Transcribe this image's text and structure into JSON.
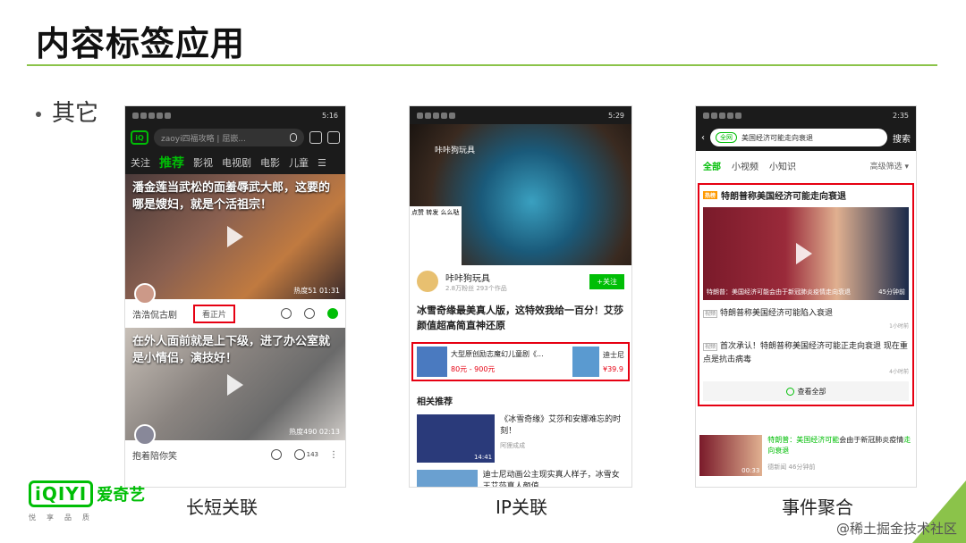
{
  "slide": {
    "title": "内容标签应用",
    "bullet": "其它",
    "captions": [
      "长短关联",
      "IP关联",
      "事件聚合"
    ],
    "watermark": "@稀土掘金技术社区",
    "logo": {
      "mark": "iQIYI",
      "name": "爱奇艺",
      "tagline": "悦享品质"
    },
    "accent": "#8bc34a",
    "highlight": "#e60012"
  },
  "phone1": {
    "time": "5:16",
    "search_placeholder": "zaoyi四福攻略 | 屈嵌...",
    "tabs": [
      "关注",
      "推荐",
      "影视",
      "电视剧",
      "电影",
      "儿童"
    ],
    "active_tab": "推荐",
    "card1": {
      "caption": "潘金莲当武松的面羞辱武大郎，这要的哪是嫂妇，就是个活祖宗！",
      "stats": "热度51  01:31",
      "author": "浩浩侃古剧",
      "watch_label": "看正片"
    },
    "card2": {
      "caption": "在外人面前就是上下级，进了办公室就是小情侣，演技好！",
      "stats": "热度490  02:13",
      "author": "抱着陪你笑",
      "likes": "143"
    }
  },
  "phone2": {
    "time": "5:29",
    "hero_tag": "咔咔狗玩具",
    "meme_text": "点赞 转发 么么哒",
    "author": "咔咔狗玩具",
    "author_sub": "2.8万粉丝 293个作品",
    "follow_label": "+关注",
    "video_title": "冰雪奇缘最美真人版，这特效我给一百分！艾莎颜值超高简直神还原",
    "goods1": {
      "title": "大型原创励志魔幻儿童剧《...",
      "price": "80元 - 900元"
    },
    "goods2": {
      "title": "迪士尼",
      "price": "¥39.9"
    },
    "rec_header": "相关推荐",
    "rec1": {
      "title": "《冰雪奇缘》艾莎和安娜难忘的时刻！",
      "sub": "阿狸成成",
      "dur": "14:41"
    },
    "rec2": {
      "title": "迪士尼动画公主现实真人样子，冰雪女王艾莎真人颜值..."
    }
  },
  "phone3": {
    "time": "2:35",
    "chip": "全网",
    "query": "美国经济可能走向衰退",
    "search_btn": "搜索",
    "tabs": [
      "全部",
      "小视频",
      "小知识"
    ],
    "filter": "高级筛选",
    "hot_label": "热榜",
    "event_title": "特朗普称美国经济可能走向衰退",
    "video_caption": "特朗普：美国经济可能会由于新冠肺炎疫情走向衰退",
    "video_dur": "45分钟前",
    "item1": {
      "label": "视频",
      "text": "特朗普称美国经济可能陷入衰退",
      "ago": "1小时前"
    },
    "item2": {
      "label": "视频",
      "text": "首次承认！特朗普称美国经济可能正走向衰退 现在重点是抗击病毒",
      "ago": "4小时前"
    },
    "more_label": "查看全部",
    "news": {
      "prefix": "特朗普：",
      "title_hl": "美国经济可能",
      "title_rest": "会由于新冠肺炎疫情",
      "title_hl2": "走向衰退",
      "source": "德新闻",
      "ago": "46分钟前",
      "dur": "00:33"
    }
  }
}
